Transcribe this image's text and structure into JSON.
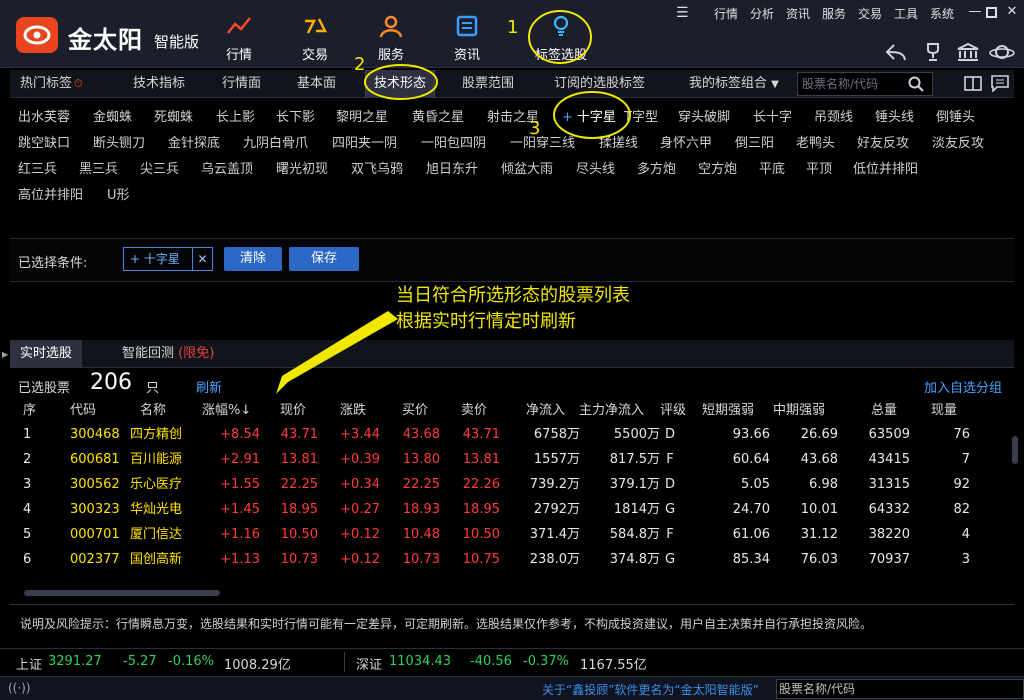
{
  "app": {
    "brand": "金太阳",
    "brand_sub": "智能版"
  },
  "nav": [
    {
      "label": "行情",
      "icon": "chart-line-icon"
    },
    {
      "label": "交易",
      "icon": "trade-icon"
    },
    {
      "label": "服务",
      "icon": "person-icon"
    },
    {
      "label": "资讯",
      "icon": "news-icon"
    },
    {
      "label": "标签选股",
      "icon": "lightbulb-icon"
    }
  ],
  "sysmenu": [
    "行情",
    "分析",
    "资讯",
    "服务",
    "交易",
    "工具",
    "系统"
  ],
  "tabs": [
    "热门标签",
    "技术指标",
    "行情面",
    "基本面",
    "技术形态",
    "股票范围",
    "订阅的选股标签",
    "我的标签组合"
  ],
  "search": {
    "placeholder": "股票名称/代码"
  },
  "tags": [
    [
      "出水芙蓉",
      "金蜘蛛",
      "死蜘蛛",
      "长上影",
      "长下影",
      "黎明之星",
      "黄昏之星",
      "射击之星",
      "十字星",
      "T字型",
      "穿头破脚",
      "长十字",
      "吊颈线",
      "锤头线",
      "倒锤头"
    ],
    [
      "跳空缺口",
      "断头铡刀",
      "金针探底",
      "九阴白骨爪",
      "四阳夹一阴",
      "一阳包四阴",
      "一阳穿三线",
      "揉搓线",
      "身怀六甲",
      "倒三阳",
      "老鸭头",
      "好友反攻",
      "淡友反攻"
    ],
    [
      "红三兵",
      "黑三兵",
      "尖三兵",
      "乌云盖顶",
      "曙光初现",
      "双飞乌鸦",
      "旭日东升",
      "倾盆大雨",
      "尽头线",
      "多方炮",
      "空方炮",
      "平底",
      "平顶",
      "低位并排阳"
    ],
    [
      "高位并排阳",
      "U形"
    ]
  ],
  "conditions": {
    "label": "已选择条件:",
    "chip": "十字星",
    "clear": "清除",
    "save": "保存"
  },
  "annotations": {
    "n1": "1",
    "n2": "2",
    "n3": "3",
    "line1": "当日符合所选形态的股票列表",
    "line2": "根据实时行情定时刷新"
  },
  "result_tabs": {
    "realtime": "实时选股",
    "backtest": "智能回测",
    "limited": "(限免)"
  },
  "summary": {
    "label": "已选股票",
    "count": "206",
    "unit": "只",
    "refresh": "刷新",
    "add_group": "加入自选分组"
  },
  "table": {
    "headers": [
      "序",
      "代码",
      "名称",
      "涨幅%↓",
      "现价",
      "涨跌",
      "买价",
      "卖价",
      "净流入",
      "主力净流入",
      "评级",
      "短期强弱",
      "中期强弱",
      "总量",
      "现量"
    ],
    "rows": [
      [
        "1",
        "300468",
        "四方精创",
        "+8.54",
        "43.71",
        "+3.44",
        "43.68",
        "43.71",
        "6758万",
        "5500万",
        "D",
        "93.66",
        "26.69",
        "63509",
        "76"
      ],
      [
        "2",
        "600681",
        "百川能源",
        "+2.91",
        "13.81",
        "+0.39",
        "13.80",
        "13.81",
        "1557万",
        "817.5万",
        "F",
        "60.64",
        "43.68",
        "43415",
        "7"
      ],
      [
        "3",
        "300562",
        "乐心医疗",
        "+1.55",
        "22.25",
        "+0.34",
        "22.25",
        "22.26",
        "739.2万",
        "379.1万",
        "D",
        "5.05",
        "6.98",
        "31315",
        "92"
      ],
      [
        "4",
        "300323",
        "华灿光电",
        "+1.45",
        "18.95",
        "+0.27",
        "18.93",
        "18.95",
        "2792万",
        "1814万",
        "G",
        "24.70",
        "10.01",
        "64332",
        "82"
      ],
      [
        "5",
        "000701",
        "厦门信达",
        "+1.16",
        "10.50",
        "+0.12",
        "10.48",
        "10.50",
        "371.4万",
        "584.8万",
        "F",
        "61.06",
        "31.12",
        "38220",
        "4"
      ],
      [
        "6",
        "002377",
        "国创高新",
        "+1.13",
        "10.73",
        "+0.12",
        "10.73",
        "10.75",
        "238.0万",
        "374.8万",
        "G",
        "85.34",
        "76.03",
        "70937",
        "3"
      ]
    ]
  },
  "disclaimer": "说明及风险提示：行情瞬息万变，选股结果和实时行情可能有一定差异，可定期刷新。选股结果仅作参考，不构成投资建议，用户自主决策并自行承担投资风险。",
  "status": {
    "sh_name": "上证",
    "sh_price": "3291.27",
    "sh_change": "-5.27",
    "sh_pct": "-0.16%",
    "sh_amount": "1008.29亿",
    "sz_name": "深证",
    "sz_price": "11034.43",
    "sz_change": "-40.56",
    "sz_pct": "-0.37%",
    "sz_amount": "1167.55亿"
  },
  "bottom": {
    "notice": "关于“鑫投顾”软件更名为“金太阳智能版”",
    "search": "股票名称/代码"
  },
  "colors": {
    "accent": "#2c67c6",
    "up": "#ff3b3b",
    "down": "#2ed15a",
    "stock_name": "#ffe100",
    "annotation": "#f0e800"
  }
}
